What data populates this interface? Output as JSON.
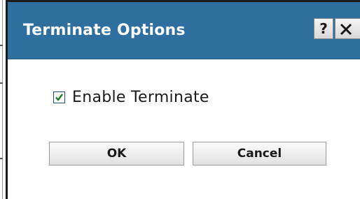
{
  "dialog": {
    "title": "Terminate Options",
    "help_label": "?",
    "close_icon": "close-icon"
  },
  "options": {
    "enable_terminate_label": "Enable Terminate",
    "enable_terminate_checked": true
  },
  "buttons": {
    "ok_label": "OK",
    "cancel_label": "Cancel"
  },
  "colors": {
    "titlebar": "#2f6f9f",
    "title_text": "#ffffff",
    "checkmark": "#1e7a1e"
  }
}
